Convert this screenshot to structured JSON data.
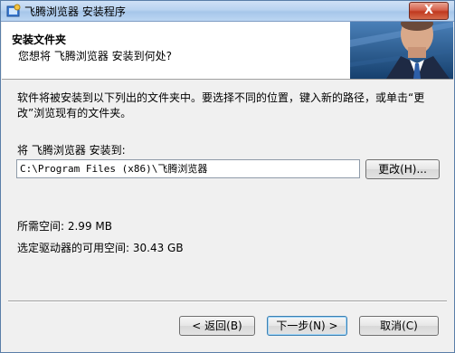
{
  "window": {
    "title": "飞腾浏览器 安装程序",
    "close_glyph": "X"
  },
  "header": {
    "title": "安装文件夹",
    "subtitle": "您想将 飞腾浏览器 安装到何处?"
  },
  "body": {
    "description": "软件将被安装到以下列出的文件夹中。要选择不同的位置，键入新的路径，或单击“更改”浏览现有的文件夹。",
    "install_label": "将 飞腾浏览器 安装到:",
    "install_path": "C:\\Program Files (x86)\\飞腾浏览器",
    "browse_button": "更改(H)...",
    "space_required": "所需空间: 2.99 MB",
    "space_available": "选定驱动器的可用空间: 30.43 GB"
  },
  "footer": {
    "back_button": "< 返回(B)",
    "next_button": "下一步(N) >",
    "cancel_button": "取消(C)"
  },
  "icons": {
    "app_icon": "installer-icon",
    "banner_image": "businessman-photo"
  }
}
